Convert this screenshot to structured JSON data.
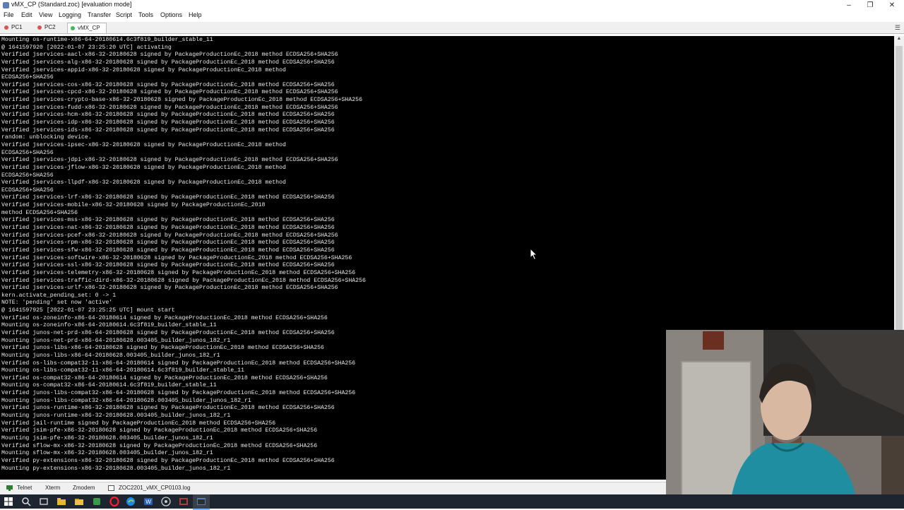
{
  "window": {
    "title": "vMX_CP (Standard.zoc) [evaluation mode]",
    "controls": [
      "–",
      "❐",
      "✕"
    ]
  },
  "menu": [
    "File",
    "Edit",
    "View",
    "Logging",
    "Transfer",
    "Script",
    "Tools",
    "Options",
    "Help"
  ],
  "tabs": [
    {
      "label": "PC1",
      "status_color": "#d9534f",
      "active": false
    },
    {
      "label": "PC2",
      "status_color": "#d9534f",
      "active": false
    },
    {
      "label": "vMX_CP",
      "status_color": "#3cba54",
      "active": true
    }
  ],
  "terminal": {
    "lines": [
      "Mounting os-runtime-x86-64-20180614.6c3f819_builder_stable_11",
      "@ 1641597920 [2022-01-07 23:25:20 UTC] activating",
      "Verified jservices-aacl-x86-32-20180628 signed by PackageProductionEc_2018 method ECDSA256+SHA256",
      "Verified jservices-alg-x86-32-20180628 signed by PackageProductionEc_2018 method ECDSA256+SHA256",
      "Verified jservices-appid-x86-32-20180628 signed by PackageProductionEc_2018 method",
      "ECDSA256+SHA256",
      "Verified jservices-cos-x86-32-20180628 signed by PackageProductionEc_2018 method ECDSA256+SHA256",
      "Verified jservices-cpcd-x86-32-20180628 signed by PackageProductionEc_2018 method ECDSA256+SHA256",
      "Verified jservices-crypto-base-x86-32-20180628 signed by PackageProductionEc_2018 method ECDSA256+SHA256",
      "Verified jservices-fudd-x86-32-20180628 signed by PackageProductionEc_2018 method ECDSA256+SHA256",
      "Verified jservices-hcm-x86-32-20180628 signed by PackageProductionEc_2018 method ECDSA256+SHA256",
      "Verified jservices-idp-x86-32-20180628 signed by PackageProductionEc_2018 method ECDSA256+SHA256",
      "Verified jservices-ids-x86-32-20180628 signed by PackageProductionEc_2018 method ECDSA256+SHA256",
      "random: unblocking device.",
      "Verified jservices-ipsec-x86-32-20180628 signed by PackageProductionEc_2018 method",
      "ECDSA256+SHA256",
      "Verified jservices-jdpi-x86-32-20180628 signed by PackageProductionEc_2018 method ECDSA256+SHA256",
      "Verified jservices-jflow-x86-32-20180628 signed by PackageProductionEc_2018 method",
      "ECDSA256+SHA256",
      "Verified jservices-llpdf-x86-32-20180628 signed by PackageProductionEc_2018 method",
      "ECDSA256+SHA256",
      "Verified jservices-lrf-x86-32-20180628 signed by PackageProductionEc_2018 method ECDSA256+SHA256",
      "Verified jservices-mobile-x86-32-20180628 signed by PackageProductionEc_2018",
      "method ECDSA256+SHA256",
      "Verified jservices-mss-x86-32-20180628 signed by PackageProductionEc_2018 method ECDSA256+SHA256",
      "Verified jservices-nat-x86-32-20180628 signed by PackageProductionEc_2018 method ECDSA256+SHA256",
      "Verified jservices-pcef-x86-32-20180628 signed by PackageProductionEc_2018 method ECDSA256+SHA256",
      "Verified jservices-rpm-x86-32-20180628 signed by PackageProductionEc_2018 method ECDSA256+SHA256",
      "Verified jservices-sfw-x86-32-20180628 signed by PackageProductionEc_2018 method ECDSA256+SHA256",
      "Verified jservices-softwire-x86-32-20180628 signed by PackageProductionEc_2018 method ECDSA256+SHA256",
      "Verified jservices-ssl-x86-32-20180628 signed by PackageProductionEc_2018 method ECDSA256+SHA256",
      "Verified jservices-telemetry-x86-32-20180628 signed by PackageProductionEc_2018 method ECDSA256+SHA256",
      "Verified jservices-traffic-dird-x86-32-20180628 signed by PackageProductionEc_2018 method ECDSA256+SHA256",
      "Verified jservices-urlf-x86-32-20180628 signed by PackageProductionEc_2018 method ECDSA256+SHA256",
      "kern.activate_pending_set: 0 -> 1",
      "NOTE: 'pending' set now 'active'",
      "@ 1641597925 [2022-01-07 23:25:25 UTC] mount start",
      "Verified os-zoneinfo-x86-64-20180614 signed by PackageProductionEc_2018 method ECDSA256+SHA256",
      "Mounting os-zoneinfo-x86-64-20180614.6c3f819_builder_stable_11",
      "Verified junos-net-prd-x86-64-20180628 signed by PackageProductionEc_2018 method ECDSA256+SHA256",
      "Mounting junos-net-prd-x86-64-20180628.003405_builder_junos_182_r1",
      "Verified junos-libs-x86-64-20180628 signed by PackageProductionEc_2018 method ECDSA256+SHA256",
      "Mounting junos-libs-x86-64-20180628.003405_builder_junos_182_r1",
      "Verified os-libs-compat32-11-x86-64-20180614 signed by PackageProductionEc_2018 method ECDSA256+SHA256",
      "Mounting os-libs-compat32-11-x86-64-20180614.6c3f819_builder_stable_11",
      "Verified os-compat32-x86-64-20180614 signed by PackageProductionEc_2018 method ECDSA256+SHA256",
      "Mounting os-compat32-x86-64-20180614.6c3f819_builder_stable_11",
      "Verified junos-libs-compat32-x86-64-20180628 signed by PackageProductionEc_2018 method ECDSA256+SHA256",
      "Mounting junos-libs-compat32-x86-64-20180628.003405_builder_junos_182_r1",
      "Verified junos-runtime-x86-32-20180628 signed by PackageProductionEc_2018 method ECDSA256+SHA256",
      "Mounting junos-runtime-x86-32-20180628.003405_builder_junos_182_r1",
      "Verified jail-runtime signed by PackageProductionEc_2018 method ECDSA256+SHA256",
      "Verified jsim-pfe-x86-32-20180628 signed by PackageProductionEc_2018 method ECDSA256+SHA256",
      "Mounting jsim-pfe-x86-32-20180628.003405_builder_junos_182_r1",
      "Verified sflow-mx-x86-32-20180628 signed by PackageProductionEc_2018 method ECDSA256+SHA256",
      "Mounting sflow-mx-x86-32-20180628.003405_builder_junos_182_r1",
      "Verified py-extensions-x86-32-20180628 signed by PackageProductionEc_2018 method ECDSA256+SHA256",
      "Mounting py-extensions-x86-32-20180628.003405_builder_junos_182_r1"
    ]
  },
  "statusbar": {
    "items": [
      "Telnet",
      "Xterm",
      "Zmodem",
      "ZOC2201_vMX_CP0103.log"
    ]
  },
  "taskbar": {
    "icons": [
      "windows-start-icon",
      "search-icon",
      "task-view-icon",
      "file-explorer-icon",
      "folder-icon",
      "opera-icon",
      "edge-icon",
      "word-icon",
      "obs-icon",
      "zoc-icon",
      "terminal-icon"
    ]
  },
  "colors": {
    "terminal_bg": "#000000",
    "terminal_fg": "#e8e8e8",
    "taskbar_bg": "#1d2530"
  }
}
